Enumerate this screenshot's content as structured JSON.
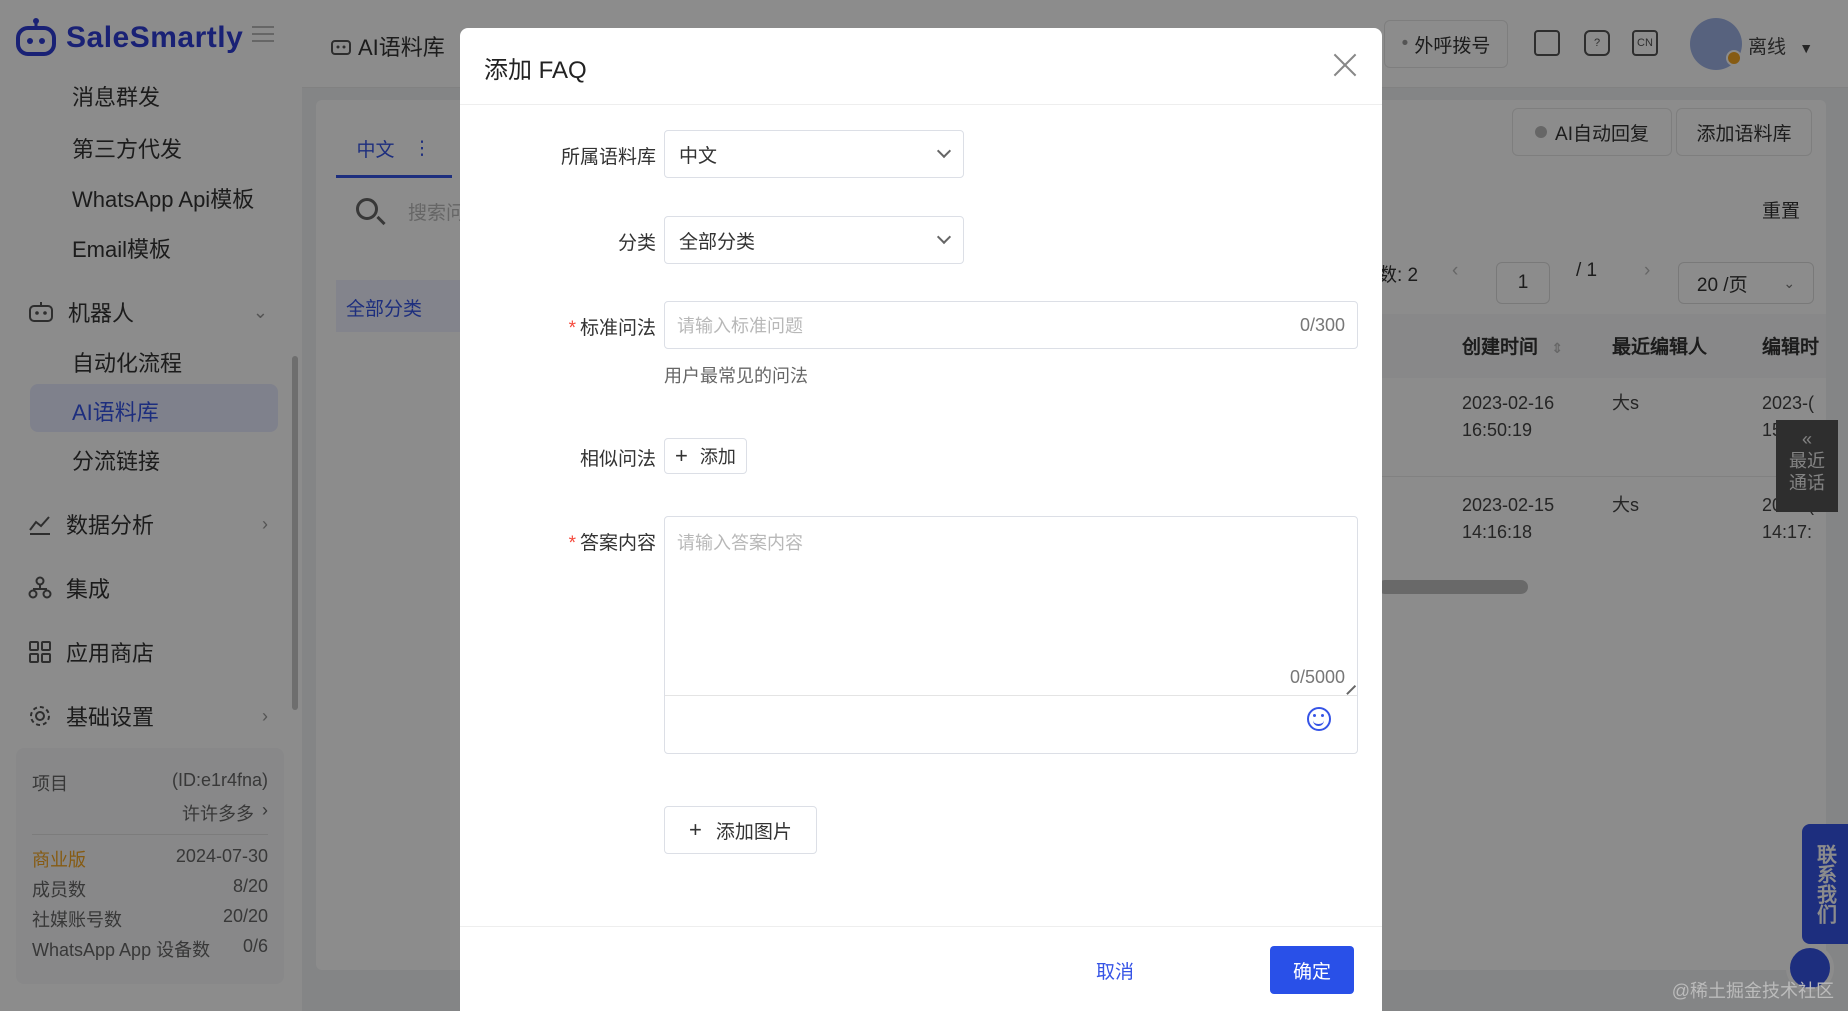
{
  "brand": {
    "name": "SaleSmartly",
    "color": "#2f3dd6"
  },
  "sidebar": {
    "sub_items": [
      "消息群发",
      "第三方代发",
      "WhatsApp Api模板",
      "Email模板"
    ],
    "robot": {
      "label": "机器人",
      "icon": "robot-icon"
    },
    "robot_sub": [
      "自动化流程",
      "AI语料库",
      "分流链接"
    ],
    "active_item": "AI语料库",
    "items": [
      {
        "label": "数据分析",
        "icon": "chart-icon"
      },
      {
        "label": "集成",
        "icon": "integration-icon"
      },
      {
        "label": "应用商店",
        "icon": "apps-icon"
      },
      {
        "label": "基础设置",
        "icon": "gear-icon"
      }
    ],
    "project": {
      "label": "项目",
      "id": "(ID:e1r4fna)",
      "name": "许许多多",
      "plan": "商业版",
      "plan_color": "#f5a623",
      "expires": "2024-07-30",
      "stats": [
        {
          "label": "成员数",
          "value": "8/20"
        },
        {
          "label": "社媒账号数",
          "value": "20/20"
        },
        {
          "label": "WhatsApp App 设备数",
          "value": "0/6"
        }
      ]
    }
  },
  "header": {
    "title": "AI语料库",
    "dial_button": "外呼拨号",
    "lang_icon": "CN",
    "user_status": "离线"
  },
  "content": {
    "tab": "中文",
    "search_placeholder": "搜索问",
    "category": "全部分类",
    "ai_auto_reply": "AI自动回复",
    "add_corpus": "添加语料库",
    "reset": "重置",
    "total_label": "数: 2",
    "page_current": "1",
    "page_total": "/ 1",
    "page_size": "20 /页",
    "columns": [
      "创建时间",
      "最近编辑人",
      "编辑时"
    ],
    "rows": [
      {
        "created_date": "2023-02-16",
        "created_time": "16:50:19",
        "editor": "大s",
        "edit_date": "2023-(",
        "edit_time": "15:11:"
      },
      {
        "created_date": "2023-02-15",
        "created_time": "14:16:18",
        "editor": "大s",
        "edit_date": "2023-(",
        "edit_time": "14:17:"
      }
    ],
    "recent_call": [
      "最近",
      "通话"
    ],
    "contact_us": "联系我们",
    "watermark": "@稀土掘金技术社区"
  },
  "modal": {
    "title": "添加 FAQ",
    "fields": {
      "corpus": {
        "label": "所属语料库",
        "value": "中文"
      },
      "category": {
        "label": "分类",
        "value": "全部分类"
      },
      "question": {
        "label": "标准问法",
        "placeholder": "请输入标准问题",
        "count": "0/300",
        "hint": "用户最常见的问法"
      },
      "similar": {
        "label": "相似问法",
        "add_label": "添加"
      },
      "answer": {
        "label": "答案内容",
        "placeholder": "请输入答案内容",
        "count": "0/5000"
      }
    },
    "add_image": "添加图片",
    "cancel": "取消",
    "confirm": "确定",
    "primary_color": "#2950e8"
  }
}
